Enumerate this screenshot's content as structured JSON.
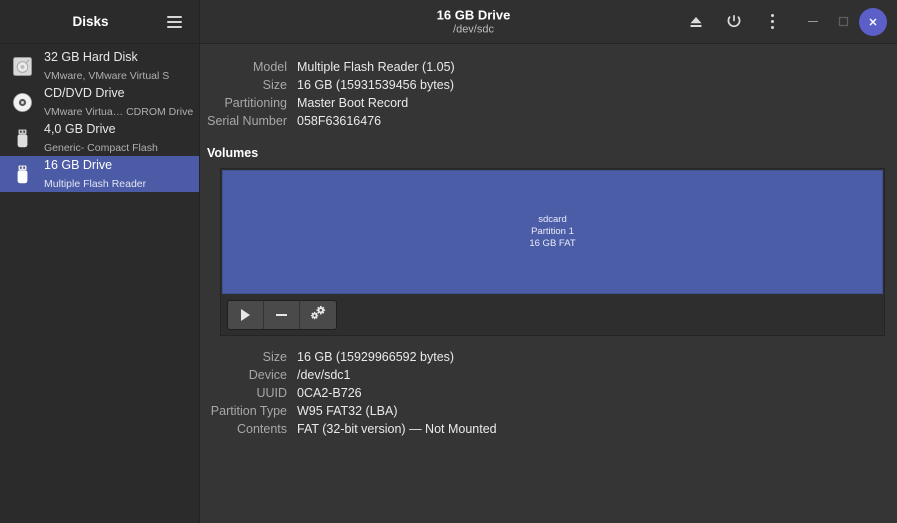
{
  "app": {
    "name": "Disks",
    "menu_icon": "hamburger-icon"
  },
  "window": {
    "title": "16 GB Drive",
    "subtitle": "/dev/sdc",
    "actions": [
      {
        "name": "eject-icon",
        "label": "Eject"
      },
      {
        "name": "power-icon",
        "label": "Power Off"
      },
      {
        "name": "more-menu-icon",
        "label": "Menu"
      }
    ],
    "controls": [
      {
        "name": "minimize-button",
        "label": "Minimize"
      },
      {
        "name": "maximize-button",
        "label": "Maximize"
      },
      {
        "name": "close-button",
        "label": "Close"
      }
    ]
  },
  "sidebar": {
    "drives": [
      {
        "icon": "hard-disk-icon",
        "name": "32 GB Hard Disk",
        "sub": "VMware, VMware Virtual S",
        "selected": false
      },
      {
        "icon": "cd-dvd-icon",
        "name": "CD/DVD Drive",
        "sub": "VMware Virtua… CDROM Drive",
        "selected": false
      },
      {
        "icon": "usb-drive-icon",
        "name": "4,0 GB Drive",
        "sub": "Generic- Compact Flash",
        "selected": false
      },
      {
        "icon": "usb-drive-icon",
        "name": "16 GB Drive",
        "sub": "Multiple Flash Reader",
        "selected": true
      }
    ]
  },
  "drive_info": {
    "rows": [
      {
        "label": "Model",
        "value": "Multiple Flash Reader (1.05)"
      },
      {
        "label": "Size",
        "value": "16 GB (15931539456 bytes)"
      },
      {
        "label": "Partitioning",
        "value": "Master Boot Record"
      },
      {
        "label": "Serial Number",
        "value": "058F63616476"
      }
    ]
  },
  "volumes": {
    "heading": "Volumes",
    "segments": [
      {
        "name": "sdcard",
        "partition": "Partition 1",
        "size": "16 GB FAT",
        "selected": true
      }
    ],
    "tools": [
      {
        "name": "mount-button",
        "icon": "play-icon",
        "label": "Mount"
      },
      {
        "name": "unmount-button",
        "icon": "minus-icon",
        "label": "Unmount"
      },
      {
        "name": "more-options-button",
        "icon": "gears-icon",
        "label": "More Options"
      }
    ]
  },
  "partition_info": {
    "rows": [
      {
        "label": "Size",
        "value": "16 GB (15929966592 bytes)"
      },
      {
        "label": "Device",
        "value": "/dev/sdc1"
      },
      {
        "label": "UUID",
        "value": "0CA2-B726"
      },
      {
        "label": "Partition Type",
        "value": "W95 FAT32 (LBA)"
      },
      {
        "label": "Contents",
        "value": "FAT (32-bit version) — Not Mounted"
      }
    ]
  },
  "colors": {
    "accent": "#4c5ba6",
    "close_button": "#5b5fc7",
    "sidebar_bg": "#2b2b2b",
    "main_bg": "#353535",
    "titlebar_bg": "#303030"
  }
}
